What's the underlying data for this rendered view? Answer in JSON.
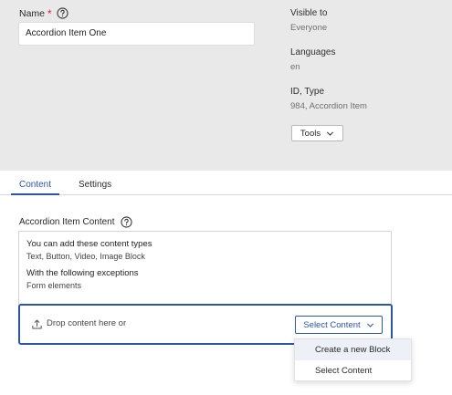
{
  "colors": {
    "accent": "#2c55a6",
    "required": "#d7263d",
    "panel_bg": "#e9e9e9"
  },
  "name_field": {
    "label": "Name",
    "required_mark": "*",
    "value": "Accordion Item One",
    "help_icon": "question-circle-icon"
  },
  "meta": {
    "visible_to_label": "Visible to",
    "visible_to_value": "Everyone",
    "languages_label": "Languages",
    "languages_value": "en",
    "id_type_label": "ID, Type",
    "id_type_value": "984, Accordion Item"
  },
  "tools_button": {
    "label": "Tools",
    "icon": "chevron-down-icon"
  },
  "tabs": [
    {
      "label": "Content",
      "active": true
    },
    {
      "label": "Settings",
      "active": false
    }
  ],
  "content_area": {
    "label": "Accordion Item Content",
    "help_icon": "question-circle-icon",
    "info_heading": "You can add these content types",
    "info_types": "Text, Button, Video, Image Block",
    "exceptions_heading": "With the following exceptions",
    "exceptions_list": "Form elements",
    "drop_text": "Drop content here or",
    "upload_icon": "upload-icon",
    "select_button_label": "Select Content",
    "select_button_icon": "chevron-down-icon"
  },
  "dropdown_menu": {
    "items": [
      {
        "label": "Create a new Block",
        "highlighted": true
      },
      {
        "label": "Select Content",
        "highlighted": false
      }
    ]
  }
}
